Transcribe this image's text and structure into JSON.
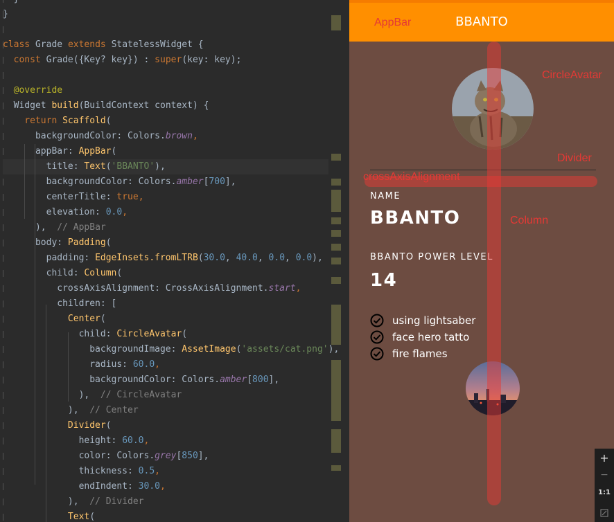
{
  "editor": {
    "lines": [
      [
        {
          "t": "  }",
          "c": "plain"
        }
      ],
      [
        {
          "t": "}",
          "c": "plain"
        }
      ],
      [
        {
          "t": "",
          "c": "plain"
        }
      ],
      [
        {
          "t": "class ",
          "c": "kw"
        },
        {
          "t": "Grade ",
          "c": "plain"
        },
        {
          "t": "extends ",
          "c": "kw"
        },
        {
          "t": "StatelessWidget {",
          "c": "plain"
        }
      ],
      [
        {
          "t": "  const ",
          "c": "kw"
        },
        {
          "t": "Grade({Key? key}) : ",
          "c": "plain"
        },
        {
          "t": "super",
          "c": "kw"
        },
        {
          "t": "(key: key);",
          "c": "plain"
        }
      ],
      [
        {
          "t": "",
          "c": "plain"
        }
      ],
      [
        {
          "t": "  @override",
          "c": "ann"
        }
      ],
      [
        {
          "t": "  Widget ",
          "c": "plain"
        },
        {
          "t": "build",
          "c": "cls"
        },
        {
          "t": "(BuildContext context) {",
          "c": "plain"
        }
      ],
      [
        {
          "t": "    return ",
          "c": "kw"
        },
        {
          "t": "Scaffold",
          "c": "cls"
        },
        {
          "t": "(",
          "c": "plain"
        }
      ],
      [
        {
          "t": "      backgroundColor: Colors.",
          "c": "plain"
        },
        {
          "t": "brown",
          "c": "prop"
        },
        {
          "t": ",",
          "c": "kw"
        }
      ],
      [
        {
          "t": "      appBar: ",
          "c": "plain"
        },
        {
          "t": "AppBar",
          "c": "cls"
        },
        {
          "t": "(",
          "c": "plain"
        }
      ],
      [
        {
          "t": "        title: ",
          "c": "plain"
        },
        {
          "t": "Text",
          "c": "cls"
        },
        {
          "t": "(",
          "c": "plain"
        },
        {
          "t": "'BBANTO'",
          "c": "str"
        },
        {
          "t": "),",
          "c": "plain"
        }
      ],
      [
        {
          "t": "        backgroundColor: Colors.",
          "c": "plain"
        },
        {
          "t": "amber",
          "c": "prop"
        },
        {
          "t": "[",
          "c": "plain"
        },
        {
          "t": "700",
          "c": "num"
        },
        {
          "t": "],",
          "c": "plain"
        }
      ],
      [
        {
          "t": "        centerTitle: ",
          "c": "plain"
        },
        {
          "t": "true",
          "c": "kw"
        },
        {
          "t": ",",
          "c": "kw"
        }
      ],
      [
        {
          "t": "        elevation: ",
          "c": "plain"
        },
        {
          "t": "0.0",
          "c": "num"
        },
        {
          "t": ",",
          "c": "kw"
        }
      ],
      [
        {
          "t": "      ),  ",
          "c": "plain"
        },
        {
          "t": "// AppBar",
          "c": "cmt"
        }
      ],
      [
        {
          "t": "      body: ",
          "c": "plain"
        },
        {
          "t": "Padding",
          "c": "cls"
        },
        {
          "t": "(",
          "c": "plain"
        }
      ],
      [
        {
          "t": "        padding: ",
          "c": "plain"
        },
        {
          "t": "EdgeInsets.fromLTRB",
          "c": "cls"
        },
        {
          "t": "(",
          "c": "plain"
        },
        {
          "t": "30.0",
          "c": "num"
        },
        {
          "t": ", ",
          "c": "plain"
        },
        {
          "t": "40.0",
          "c": "num"
        },
        {
          "t": ", ",
          "c": "plain"
        },
        {
          "t": "0.0",
          "c": "num"
        },
        {
          "t": ", ",
          "c": "plain"
        },
        {
          "t": "0.0",
          "c": "num"
        },
        {
          "t": "),",
          "c": "plain"
        }
      ],
      [
        {
          "t": "        child: ",
          "c": "plain"
        },
        {
          "t": "Column",
          "c": "cls"
        },
        {
          "t": "(",
          "c": "plain"
        }
      ],
      [
        {
          "t": "          crossAxisAlignment: CrossAxisAlignment.",
          "c": "plain"
        },
        {
          "t": "start",
          "c": "prop"
        },
        {
          "t": ",",
          "c": "kw"
        }
      ],
      [
        {
          "t": "          children: [",
          "c": "plain"
        }
      ],
      [
        {
          "t": "            ",
          "c": "plain"
        },
        {
          "t": "Center",
          "c": "cls"
        },
        {
          "t": "(",
          "c": "plain"
        }
      ],
      [
        {
          "t": "              child: ",
          "c": "plain"
        },
        {
          "t": "CircleAvatar",
          "c": "cls"
        },
        {
          "t": "(",
          "c": "plain"
        }
      ],
      [
        {
          "t": "                backgroundImage: ",
          "c": "plain"
        },
        {
          "t": "AssetImage",
          "c": "cls"
        },
        {
          "t": "(",
          "c": "plain"
        },
        {
          "t": "'assets/cat.png'",
          "c": "str"
        },
        {
          "t": "),",
          "c": "plain"
        }
      ],
      [
        {
          "t": "                radius: ",
          "c": "plain"
        },
        {
          "t": "60.0",
          "c": "num"
        },
        {
          "t": ",",
          "c": "kw"
        }
      ],
      [
        {
          "t": "                backgroundColor: Colors.",
          "c": "plain"
        },
        {
          "t": "amber",
          "c": "prop"
        },
        {
          "t": "[",
          "c": "plain"
        },
        {
          "t": "800",
          "c": "num"
        },
        {
          "t": "],",
          "c": "plain"
        }
      ],
      [
        {
          "t": "              ),  ",
          "c": "plain"
        },
        {
          "t": "// CircleAvatar",
          "c": "cmt"
        }
      ],
      [
        {
          "t": "            ),  ",
          "c": "plain"
        },
        {
          "t": "// Center",
          "c": "cmt"
        }
      ],
      [
        {
          "t": "            ",
          "c": "plain"
        },
        {
          "t": "Divider",
          "c": "cls"
        },
        {
          "t": "(",
          "c": "plain"
        }
      ],
      [
        {
          "t": "              height: ",
          "c": "plain"
        },
        {
          "t": "60.0",
          "c": "num"
        },
        {
          "t": ",",
          "c": "kw"
        }
      ],
      [
        {
          "t": "              color: Colors.",
          "c": "plain"
        },
        {
          "t": "grey",
          "c": "prop"
        },
        {
          "t": "[",
          "c": "plain"
        },
        {
          "t": "850",
          "c": "num"
        },
        {
          "t": "],",
          "c": "plain"
        }
      ],
      [
        {
          "t": "              thickness: ",
          "c": "plain"
        },
        {
          "t": "0.5",
          "c": "num"
        },
        {
          "t": ",",
          "c": "kw"
        }
      ],
      [
        {
          "t": "              endIndent: ",
          "c": "plain"
        },
        {
          "t": "30.0",
          "c": "num"
        },
        {
          "t": ",",
          "c": "kw"
        }
      ],
      [
        {
          "t": "            ),  ",
          "c": "plain"
        },
        {
          "t": "// Divider",
          "c": "cmt"
        }
      ],
      [
        {
          "t": "            ",
          "c": "plain"
        },
        {
          "t": "Text",
          "c": "cls"
        },
        {
          "t": "(",
          "c": "plain"
        }
      ]
    ]
  },
  "device": {
    "appbar_title": "BBANTO",
    "debug_labels": {
      "appbar": "AppBar",
      "circle_avatar": "CircleAvatar",
      "divider": "Divider",
      "cross_axis": "crossAxisAlignment",
      "column": "Column"
    },
    "name_label": "NAME",
    "name_value": "BBANTO",
    "power_label": "BBANTO POWER LEVEL",
    "power_value": "14",
    "skills": [
      "using lightsaber",
      "face hero tatto",
      "fire flames"
    ],
    "images": {
      "avatar_top": "cat-photo",
      "avatar_bottom": "sunset-city-photo"
    },
    "icons": {
      "check": "check-circle-icon"
    }
  },
  "zoom": {
    "plus": "+",
    "minus": "−",
    "ratio": "1:1"
  },
  "colors": {
    "appbar": "#ff8f00",
    "background": "#6d4c41",
    "debug": "#e53935"
  }
}
